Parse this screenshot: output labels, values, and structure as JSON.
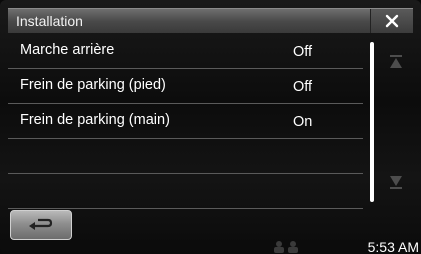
{
  "header": {
    "title": "Installation",
    "close_icon": "close-icon"
  },
  "settings": {
    "rows": [
      {
        "label": "Marche arrière",
        "value": "Off"
      },
      {
        "label": "Frein de parking (pied)",
        "value": "Off"
      },
      {
        "label": "Frein de parking (main)",
        "value": "On"
      },
      {
        "label": "",
        "value": ""
      },
      {
        "label": "",
        "value": ""
      }
    ]
  },
  "scroll": {
    "up_icon": "arrow-up-icon",
    "down_icon": "arrow-down-icon"
  },
  "footer": {
    "back_icon": "back-arrow-icon",
    "clock": "5:53 AM"
  },
  "colors": {
    "title_bar": "#555555",
    "text": "#ffffff",
    "divider": "#5a5a5a"
  }
}
